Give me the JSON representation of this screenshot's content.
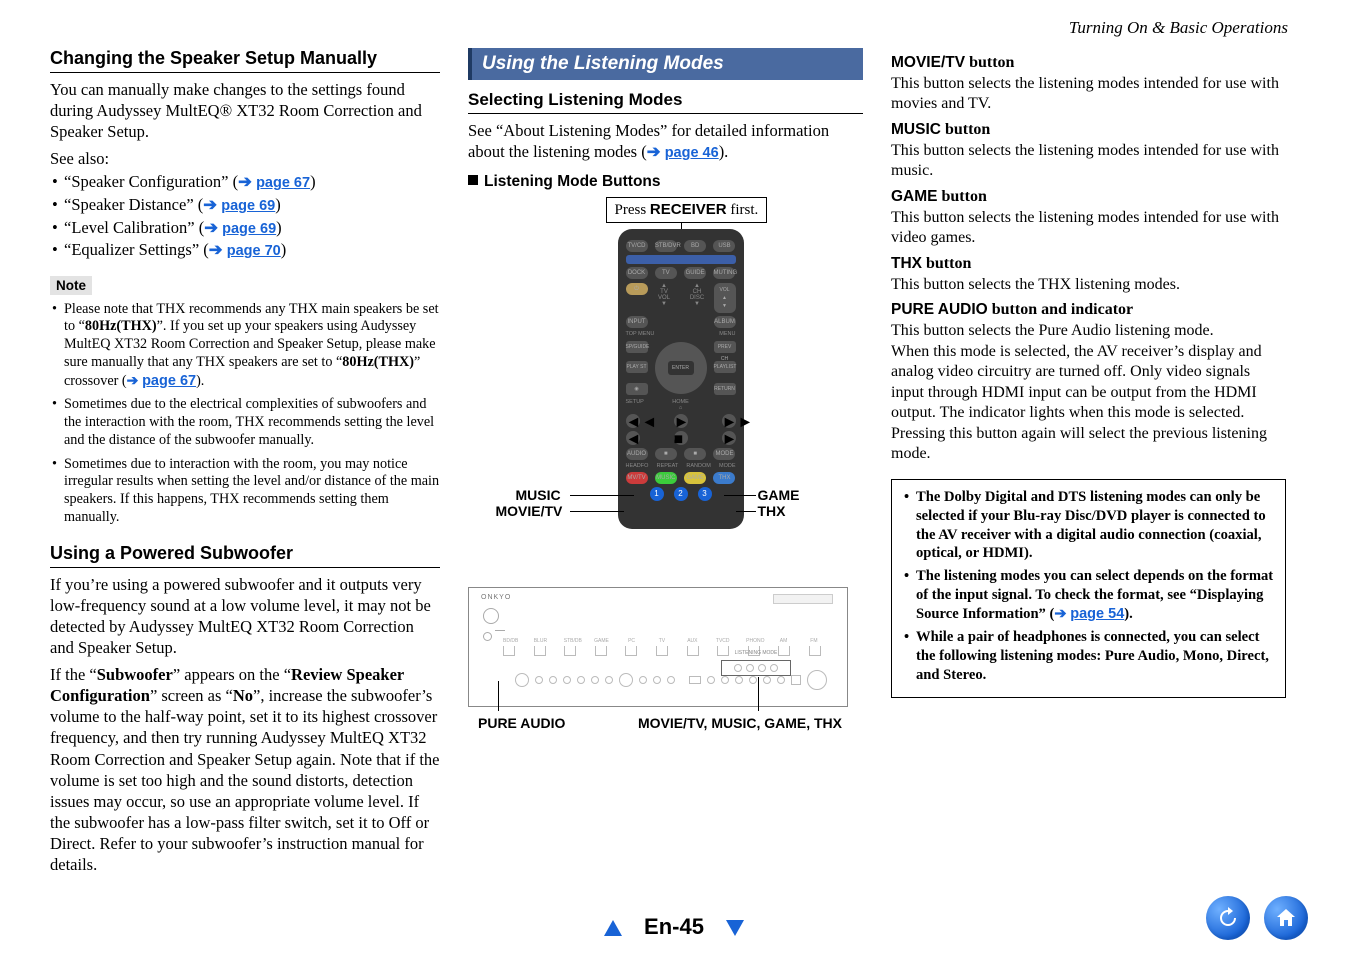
{
  "header": {
    "breadcrumb": "Turning On & Basic Operations"
  },
  "col1": {
    "h1": "Changing the Speaker Setup Manually",
    "p1": "You can manually make changes to the settings found during Audyssey MultEQ® XT32 Room Correction and Speaker Setup.",
    "see_also": "See also:",
    "links": [
      {
        "label": "“Speaker Configuration” (",
        "page": "page 67",
        "close": ")"
      },
      {
        "label": "“Speaker Distance” (",
        "page": "page 69",
        "close": ")"
      },
      {
        "label": "“Level Calibration” (",
        "page": "page 69",
        "close": ")"
      },
      {
        "label": "“Equalizer Settings” (",
        "page": "page 70",
        "close": ")"
      }
    ],
    "note_label": "Note",
    "notes": [
      {
        "pre": "Please note that THX recommends any THX main speakers be set to “",
        "b1": "80Hz(THX)",
        "mid": "”. If you set up your speakers using Audyssey MultEQ XT32 Room Correction and Speaker Setup, please make sure manually that any THX speakers are set to “",
        "b2": "80Hz(THX)",
        "post": "” crossover (",
        "page": "page 67",
        "end": ")."
      },
      {
        "text": "Sometimes due to the electrical complexities of subwoofers and the interaction with the room, THX recommends setting the level and the distance of the subwoofer manually."
      },
      {
        "text": "Sometimes due to interaction with the room, you may notice irregular results when setting the level and/or distance of the main speakers. If this happens, THX recommends setting them manually."
      }
    ],
    "h2": "Using a Powered Subwoofer",
    "p2a": "If you’re using a powered subwoofer and it outputs very low-frequency sound at a low volume level, it may not be detected by Audyssey MultEQ XT32 Room Correction and Speaker Setup.",
    "p2b_pre": "If the “",
    "p2b_b1": "Subwoofer",
    "p2b_mid1": "” appears on the “",
    "p2b_b2": "Review Speaker Configuration",
    "p2b_mid2": "” screen as “",
    "p2b_b3": "No",
    "p2b_post": "”, increase the subwoofer’s volume to the half-way point, set it to its highest crossover frequency, and then try running Audyssey MultEQ XT32 Room Correction and Speaker Setup again. Note that if the volume is set too high and the sound distorts, detection issues may occur, so use an appropriate volume level. If the subwoofer has a low-pass filter switch, set it to Off or Direct. Refer to your subwoofer’s instruction manual for details."
  },
  "col2": {
    "bigheader": "Using the Listening Modes",
    "sub": "Selecting Listening Modes",
    "p1_pre": "See “About Listening Modes” for detailed information about the listening modes (",
    "p1_page": "page 46",
    "p1_post": ").",
    "buttons_head": "Listening Mode Buttons",
    "press_pre": "Press ",
    "press_bold": "RECEIVER",
    "press_post": " first.",
    "remote_labels": {
      "music": "MUSIC",
      "movietv": "MOVIE/TV",
      "game": "GAME",
      "thx": "THX"
    },
    "receiver_caption": {
      "left": "PURE AUDIO",
      "right": "MOVIE/TV, MUSIC, GAME, THX"
    },
    "receiver_brand": "ONKYO"
  },
  "col3": {
    "defs": [
      {
        "term": "MOVIE/TV",
        "suffix": " button",
        "desc": "This button selects the listening modes intended for use with movies and TV."
      },
      {
        "term": "MUSIC",
        "suffix": " button",
        "desc": "This button selects the listening modes intended for use with music."
      },
      {
        "term": "GAME",
        "suffix": " button",
        "desc": "This button selects the listening modes intended for use with video games."
      },
      {
        "term": "THX",
        "suffix": " button",
        "desc": "This button selects the THX listening modes."
      },
      {
        "term": "PURE AUDIO",
        "suffix": " button and indicator",
        "desc": "This button selects the Pure Audio listening mode.\nWhen this mode is selected, the AV receiver’s display and analog video circuitry are turned off. Only video signals input through HDMI input can be output from the HDMI output. The indicator lights when this mode is selected. Pressing this button again will select the previous listening mode."
      }
    ],
    "tips": [
      {
        "text": "The Dolby Digital and DTS listening modes can only be selected if your Blu-ray Disc/DVD player is connected to the AV receiver with a digital audio connection (coaxial, optical, or HDMI)."
      },
      {
        "pre": "The listening modes you can select depends on the format of the input signal. To check the format, see “Displaying Source Information” (",
        "page": "page 54",
        "post": ")."
      },
      {
        "text": "While a pair of headphones is connected, you can select the following listening modes: Pure Audio, Mono, Direct, and Stereo."
      }
    ]
  },
  "footer": {
    "page": "En-45"
  }
}
